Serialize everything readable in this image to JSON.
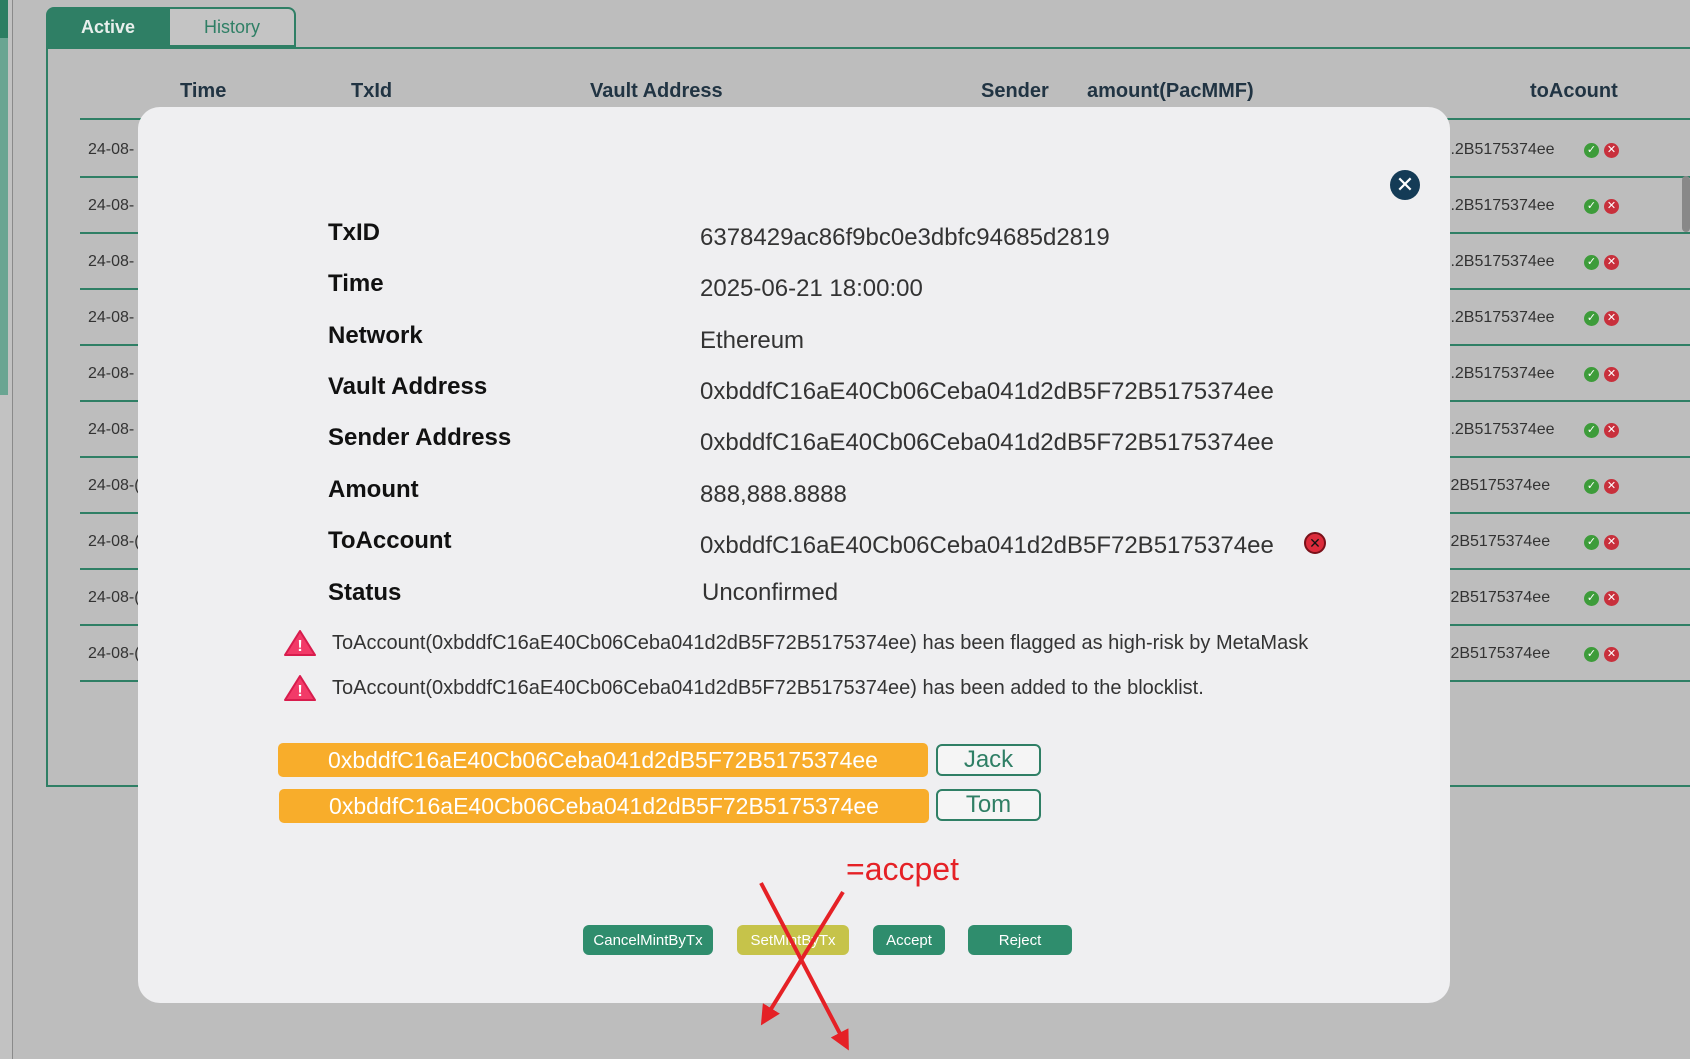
{
  "tabs": {
    "active": "Active",
    "history": "History"
  },
  "table": {
    "headers": {
      "time": "Time",
      "txid": "TxId",
      "vault": "Vault Address",
      "sender": "Sender",
      "amount": "amount(PacMMF)",
      "to": "toAcount"
    },
    "rows": [
      {
        "date": "24-08-",
        "to": "..2B5175374ee"
      },
      {
        "date": "24-08-",
        "to": "..2B5175374ee"
      },
      {
        "date": "24-08-",
        "to": "..2B5175374ee"
      },
      {
        "date": "24-08-",
        "to": "..2B5175374ee"
      },
      {
        "date": "24-08-",
        "to": "..2B5175374ee"
      },
      {
        "date": "24-08-",
        "to": "..2B5175374ee"
      },
      {
        "date": "24-08-(",
        "to": ".2B5175374ee"
      },
      {
        "date": "24-08-(",
        "to": ".2B5175374ee"
      },
      {
        "date": "24-08-(",
        "to": ".2B5175374ee"
      },
      {
        "date": "24-08-(",
        "to": ".2B5175374ee"
      }
    ]
  },
  "modal": {
    "fields": {
      "txid_label": "TxID",
      "txid": "6378429ac86f9bc0e3dbfc94685d2819",
      "time_label": "Time",
      "time": "2025-06-21 18:00:00",
      "network_label": "Network",
      "network": "Ethereum",
      "vault_label": "Vault Address",
      "vault": "0xbddfC16aE40Cb06Ceba041d2dB5F72B5175374ee",
      "sender_label": "Sender Address",
      "sender": "0xbddfC16aE40Cb06Ceba041d2dB5F72B5175374ee",
      "amount_label": "Amount",
      "amount": "888,888.8888",
      "to_label": "ToAccount",
      "to": "0xbddfC16aE40Cb06Ceba041d2dB5F72B5175374ee",
      "status_label": "Status",
      "status": "Unconfirmed"
    },
    "warnings": [
      "ToAccount(0xbddfC16aE40Cb06Ceba041d2dB5F72B5175374ee) has been flagged as high-risk by MetaMask",
      "ToAccount(0xbddfC16aE40Cb06Ceba041d2dB5F72B5175374ee) has been added to the blocklist."
    ],
    "contacts": [
      {
        "address": "0xbddfC16aE40Cb06Ceba041d2dB5F72B5175374ee",
        "name": "Jack"
      },
      {
        "address": "0xbddfC16aE40Cb06Ceba041d2dB5F72B5175374ee",
        "name": "Tom"
      }
    ],
    "buttons": {
      "cancel": "CancelMintByTx",
      "setmint": "SetMintByTx",
      "accept": "Accept",
      "reject": "Reject"
    },
    "annotation": "=accpet"
  },
  "colors": {
    "accent": "#2f7f65",
    "warning_pill": "#f8ad2b",
    "danger": "#dc2b3b",
    "annotation": "#e52126"
  },
  "icons": {
    "close": "close-icon",
    "check": "check-icon",
    "reject": "x-circle-icon",
    "warning": "warning-triangle-icon"
  }
}
